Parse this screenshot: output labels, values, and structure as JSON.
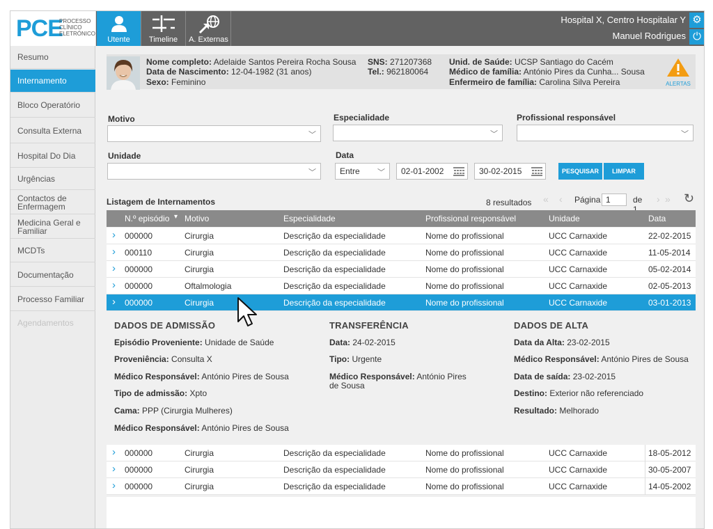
{
  "app": {
    "logo": "PCE",
    "logo_sub": "PROCESSO CLÍNICO ELETRÓNICO",
    "nav": [
      {
        "label": "Utente"
      },
      {
        "label": "Timeline"
      },
      {
        "label": "A. Externas"
      }
    ],
    "hospital": "Hospital X, Centro Hospitalar Y",
    "user": "Manuel Rodrigues",
    "accent": "#1e9dd8"
  },
  "sidebar": {
    "items": [
      {
        "label": "Resumo"
      },
      {
        "label": "Internamento"
      },
      {
        "label": "Bloco Operatório"
      },
      {
        "label": "Consulta Externa"
      },
      {
        "label": "Hospital Do Dia"
      },
      {
        "label": "Urgências"
      },
      {
        "label": "Contactos de Enfermagem"
      },
      {
        "label": "Medicina Geral e Familiar"
      },
      {
        "label": "MCDTs"
      },
      {
        "label": "Documentação"
      },
      {
        "label": "Processo Familiar"
      },
      {
        "label": "Agendamentos"
      }
    ]
  },
  "patient": {
    "name_label": "Nome completo:",
    "name": "Adelaide Santos Pereira Rocha Sousa",
    "dob_label": "Data de Nascimento:",
    "dob": "12-04-1982 (31 anos)",
    "sex_label": "Sexo:",
    "sex": "Feminino",
    "sns_label": "SNS:",
    "sns": "271207368",
    "tel_label": "Tel.:",
    "tel": "962180064",
    "unit_label": "Unid. de Saúde:",
    "unit": "UCSP Santiago do Cacém",
    "doctor_label": "Médico de família:",
    "doctor": "António Pires da Cunha... Sousa",
    "nurse_label": "Enfermeiro de família:",
    "nurse": "Carolina Silva Pereira",
    "alerts": "ALERTAS"
  },
  "filters": {
    "motivo": "Motivo",
    "especialidade": "Especialidade",
    "profissional": "Profissional responsável",
    "unidade": "Unidade",
    "data": "Data",
    "data_op": "Entre",
    "data_from": "02-01-2002",
    "data_to": "30-02-2015",
    "search": "PESQUISAR",
    "clear": "LIMPAR"
  },
  "list": {
    "title": "Listagem de Internamentos",
    "results": "8 resultados",
    "page_label": "Página",
    "page": "1",
    "page_of": "de 1",
    "headers": [
      "N.º episódio",
      "Motivo",
      "Especialidade",
      "Profissional responsável",
      "Unidade",
      "Data"
    ],
    "rows": [
      [
        "000000",
        "Cirurgia",
        "Descrição da especialidade",
        "Nome do profissional",
        "UCC Carnaxide",
        "22-02-2015"
      ],
      [
        "000110",
        "Cirurgia",
        "Descrição da especialidade",
        "Nome do profissional",
        "UCC Carnaxide",
        "11-05-2014"
      ],
      [
        "000000",
        "Cirurgia",
        "Descrição da especialidade",
        "Nome do profissional",
        "UCC Carnaxide",
        "05-02-2014"
      ],
      [
        "000000",
        "Oftalmologia",
        "Descrição da especialidade",
        "Nome do profissional",
        "UCC Carnaxide",
        "02-05-2013"
      ],
      [
        "000000",
        "Cirurgia",
        "Descrição da especialidade",
        "Nome do profissional",
        "UCC Carnaxide",
        "03-01-2013"
      ],
      [
        "000000",
        "Cirurgia",
        "Descrição da especialidade",
        "Nome do profissional",
        "UCC Carnaxide",
        "18-05-2012"
      ],
      [
        "000000",
        "Cirurgia",
        "Descrição da especialidade",
        "Nome do profissional",
        "UCC Carnaxide",
        "30-05-2007"
      ],
      [
        "000000",
        "Cirurgia",
        "Descrição da especialidade",
        "Nome do profissional",
        "UCC Carnaxide",
        "14-05-2002"
      ]
    ]
  },
  "detail": {
    "admissao_title": "DADOS DE ADMISSÃO",
    "adm": [
      {
        "k": "Episódio Proveniente:",
        "v": "Unidade de Saúde"
      },
      {
        "k": "Proveniência:",
        "v": "Consulta X"
      },
      {
        "k": "Médico Responsável:",
        "v": "António Pires de Sousa"
      },
      {
        "k": "Tipo de admissão:",
        "v": "Xpto"
      },
      {
        "k": "Cama:",
        "v": "PPP (Cirurgia Mulheres)"
      },
      {
        "k": "Médico Responsável:",
        "v": "António Pires de Sousa"
      }
    ],
    "transf_title": "TRANSFERÊNCIA",
    "transf": [
      {
        "k": "Data:",
        "v": "24-02-2015"
      },
      {
        "k": "Tipo:",
        "v": "Urgente"
      },
      {
        "k": "Médico Responsável:",
        "v": "António Pires"
      },
      {
        "k": "",
        "v": "de Sousa"
      }
    ],
    "alta_title": "DADOS DE ALTA",
    "alta": [
      {
        "k": "Data da Alta:",
        "v": "23-02-2015"
      },
      {
        "k": "Médico Responsável:",
        "v": "António Pires de Sousa"
      },
      {
        "k": "Data de saída:",
        "v": "23-02-2015"
      },
      {
        "k": "Destino:",
        "v": "Exterior não referenciado"
      },
      {
        "k": "Resultado:",
        "v": "Melhorado"
      }
    ]
  }
}
